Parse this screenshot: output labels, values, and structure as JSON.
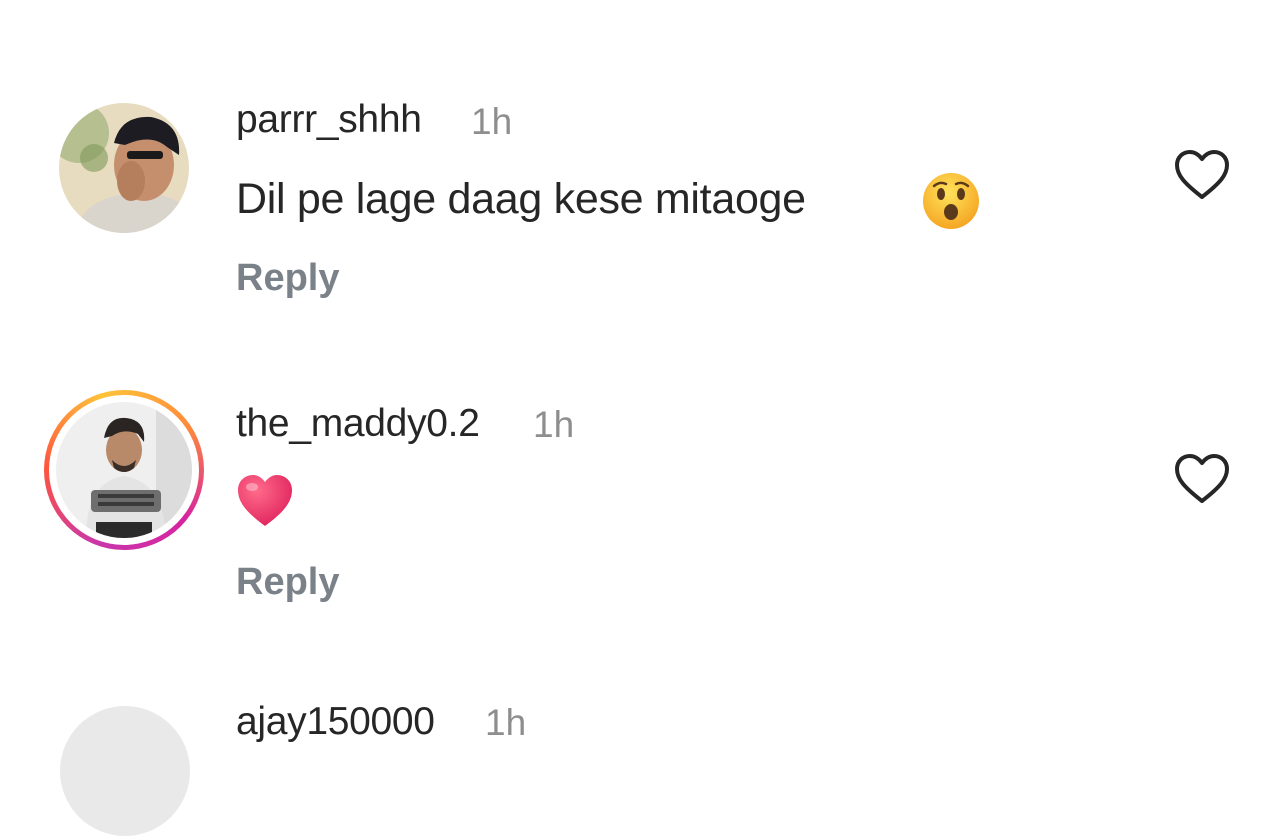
{
  "comments": [
    {
      "username": "parrr_shhh",
      "time": "1h",
      "text": "Dil pe lage daag kese mitaoge",
      "emoji": "hushed-face-emoji",
      "reply_label": "Reply",
      "avatar_story_ring": false
    },
    {
      "username": "the_maddy0.2",
      "time": "1h",
      "text": "",
      "emoji": "red-heart-emoji",
      "reply_label": "Reply",
      "avatar_story_ring": true
    },
    {
      "username": "ajay150000",
      "time": "1h"
    }
  ],
  "icons": {
    "like": "heart-outline-icon"
  },
  "colors": {
    "username": "#262626",
    "meta": "#8e8e8e",
    "reply": "#7a8188",
    "story_ring": [
      "#c837ab",
      "#ff543e",
      "#ffc43a"
    ]
  }
}
